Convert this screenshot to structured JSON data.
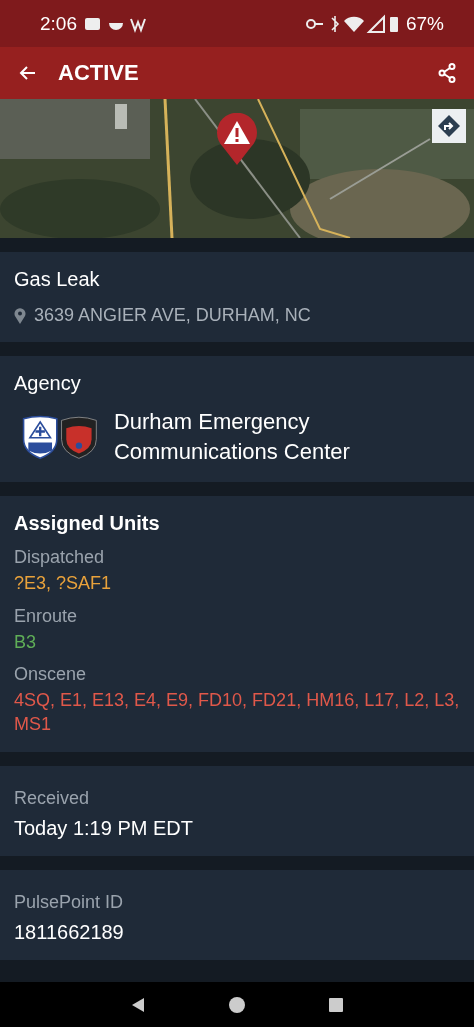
{
  "status_bar": {
    "time": "2:06",
    "battery": "67%"
  },
  "app_bar": {
    "title": "ACTIVE"
  },
  "incident": {
    "type": "Gas Leak",
    "address": "3639 ANGIER AVE, DURHAM, NC"
  },
  "agency": {
    "label": "Agency",
    "name": "Durham Emergency Communications Center"
  },
  "assigned_units": {
    "label": "Assigned Units",
    "groups": [
      {
        "status": "Dispatched",
        "units": "?E3, ?SAF1",
        "color": "#e9a23b"
      },
      {
        "status": "Enroute",
        "units": "B3",
        "color": "#5fae57"
      },
      {
        "status": "Onscene",
        "units": "4SQ, E1, E13, E4, E9, FD10, FD21, HM16, L17, L2, L3, MS1",
        "color": "#e0584a"
      }
    ]
  },
  "received": {
    "label": "Received",
    "value": "Today 1:19 PM EDT"
  },
  "pulsepoint_id": {
    "label": "PulsePoint ID",
    "value": "1811662189"
  }
}
